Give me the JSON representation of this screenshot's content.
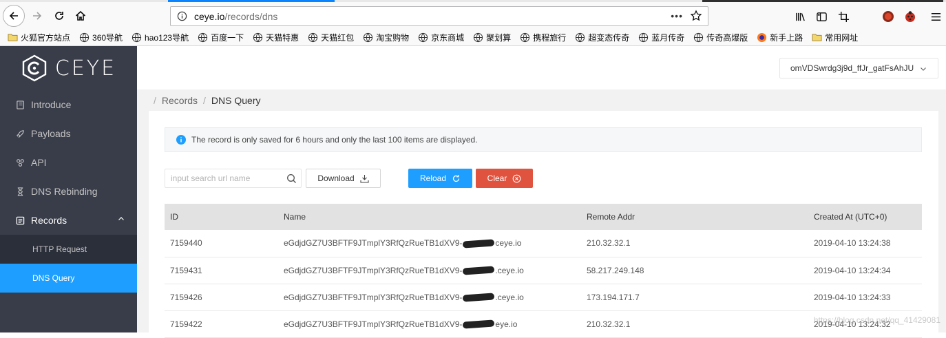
{
  "browser": {
    "url_host": "ceye.io",
    "url_path": "/records/dns",
    "more_label": "•••",
    "bookmarks": [
      {
        "label": "火狐官方站点",
        "icon": "folder-icon"
      },
      {
        "label": "360导航",
        "icon": "globe-icon"
      },
      {
        "label": "hao123导航",
        "icon": "globe-icon"
      },
      {
        "label": "百度一下",
        "icon": "globe-icon"
      },
      {
        "label": "天猫特惠",
        "icon": "globe-icon"
      },
      {
        "label": "天猫红包",
        "icon": "globe-icon"
      },
      {
        "label": "淘宝购物",
        "icon": "globe-icon"
      },
      {
        "label": "京东商城",
        "icon": "globe-icon"
      },
      {
        "label": "聚划算",
        "icon": "globe-icon"
      },
      {
        "label": "携程旅行",
        "icon": "globe-icon"
      },
      {
        "label": "超变态传奇",
        "icon": "globe-icon"
      },
      {
        "label": "蓝月传奇",
        "icon": "globe-icon"
      },
      {
        "label": "传奇高爆版",
        "icon": "globe-icon"
      },
      {
        "label": "新手上路",
        "icon": "firefox-icon"
      },
      {
        "label": "常用网址",
        "icon": "folder-icon"
      }
    ]
  },
  "app": {
    "logo_text": "CEYE",
    "token": "omVDSwrdg3j9d_ffJr_gatFsAhJU",
    "menu": [
      {
        "label": "Introduce",
        "icon": "book-icon"
      },
      {
        "label": "Payloads",
        "icon": "rocket-icon"
      },
      {
        "label": "API",
        "icon": "api-icon"
      },
      {
        "label": "DNS Rebinding",
        "icon": "hourglass-icon"
      },
      {
        "label": "Records",
        "icon": "records-icon"
      }
    ],
    "submenu": [
      {
        "label": "HTTP Request"
      },
      {
        "label": "DNS Query"
      }
    ],
    "breadcrumb": {
      "sep": "/",
      "parent": "Records",
      "current": "DNS Query"
    },
    "notice": "The record is only saved for 6 hours and only the last 100 items are displayed.",
    "search_placeholder": "input search url name",
    "download_label": "Download",
    "reload_label": "Reload",
    "clear_label": "Clear",
    "table": {
      "headers": [
        "ID",
        "Name",
        "Remote Addr",
        "Created At (UTC+0)"
      ],
      "rows": [
        {
          "id": "7159440",
          "name_prefix": "eGdjdGZ7U3BFTF9JTmplY3RfQzRueTB1dXV9-",
          "name_suffix": "ceye.io",
          "addr": "210.32.32.1",
          "created": "2019-04-10 13:24:38"
        },
        {
          "id": "7159431",
          "name_prefix": "eGdjdGZ7U3BFTF9JTmplY3RfQzRueTB1dXV9-",
          "name_suffix": ".ceye.io",
          "addr": "58.217.249.148",
          "created": "2019-04-10 13:24:34"
        },
        {
          "id": "7159426",
          "name_prefix": "eGdjdGZ7U3BFTF9JTmplY3RfQzRueTB1dXV9-",
          "name_suffix": ".ceye.io",
          "addr": "173.194.171.7",
          "created": "2019-04-10 13:24:33"
        },
        {
          "id": "7159422",
          "name_prefix": "eGdjdGZ7U3BFTF9JTmplY3RfQzRueTB1dXV9-",
          "name_suffix": "eye.io",
          "addr": "210.32.32.1",
          "created": "2019-04-10 13:24:32"
        }
      ]
    },
    "watermark": "https://blog.csdn.net/qq_41429081"
  },
  "colors": {
    "sidebar": "#393d49",
    "active": "#1e9fff",
    "clear": "#e0533e"
  }
}
